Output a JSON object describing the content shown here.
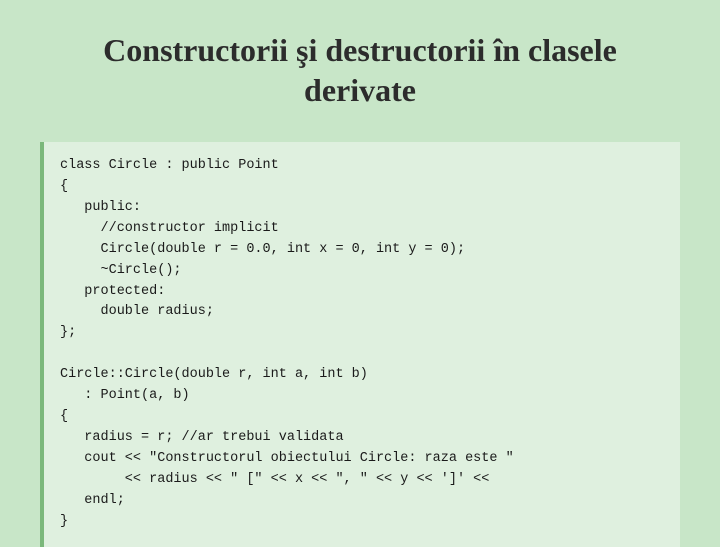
{
  "slide": {
    "title_line1": "Constructorii şi destructorii în clasele",
    "title_line2": "derivate",
    "code": "class Circle : public Point\n{\n   public:\n     //constructor implicit\n     Circle(double r = 0.0, int x = 0, int y = 0);\n     ~Circle();\n   protected:\n     double radius;\n};\n\nCircle::Circle(double r, int a, int b)\n   : Point(a, b)\n{\n   radius = r; //ar trebui validata\n   cout << \"Constructorul obiectului Circle: raza este \"\n        << radius << \" [\" << x << \", \" << y << ']' <<\n   endl;\n}"
  }
}
